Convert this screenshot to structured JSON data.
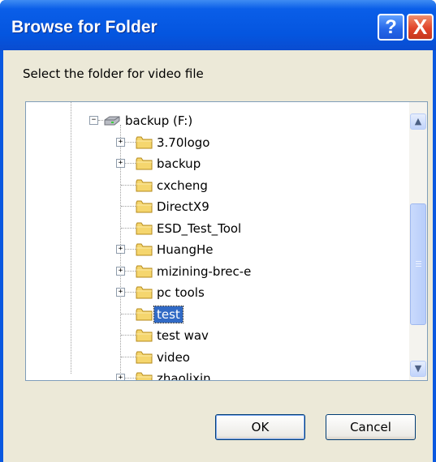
{
  "window": {
    "title": "Browse for Folder",
    "help_glyph": "?",
    "close_glyph": "X"
  },
  "prompt": "Select the folder for video file",
  "tree": {
    "drive": {
      "label": "backup (F:)",
      "expander": "−",
      "icon": "drive-icon"
    },
    "items": [
      {
        "label": "3.70logo",
        "expander": "+"
      },
      {
        "label": "backup",
        "expander": "+"
      },
      {
        "label": "cxcheng",
        "expander": ""
      },
      {
        "label": "DirectX9",
        "expander": ""
      },
      {
        "label": "ESD_Test_Tool",
        "expander": ""
      },
      {
        "label": "HuangHe",
        "expander": "+"
      },
      {
        "label": "mizining-brec-e",
        "expander": "+"
      },
      {
        "label": "pc tools",
        "expander": "+"
      },
      {
        "label": "test",
        "expander": "",
        "selected": true
      },
      {
        "label": "test wav",
        "expander": ""
      },
      {
        "label": "video",
        "expander": ""
      },
      {
        "label": "zhaolixin",
        "expander": "+"
      }
    ]
  },
  "scroll": {
    "up_glyph": "▲",
    "down_glyph": "▼"
  },
  "buttons": {
    "ok": "OK",
    "cancel": "Cancel"
  },
  "colors": {
    "titlebar": "#0455df",
    "selection": "#316ac5",
    "folder": "#f5d66e",
    "dialog_bg": "#ece9d8"
  }
}
